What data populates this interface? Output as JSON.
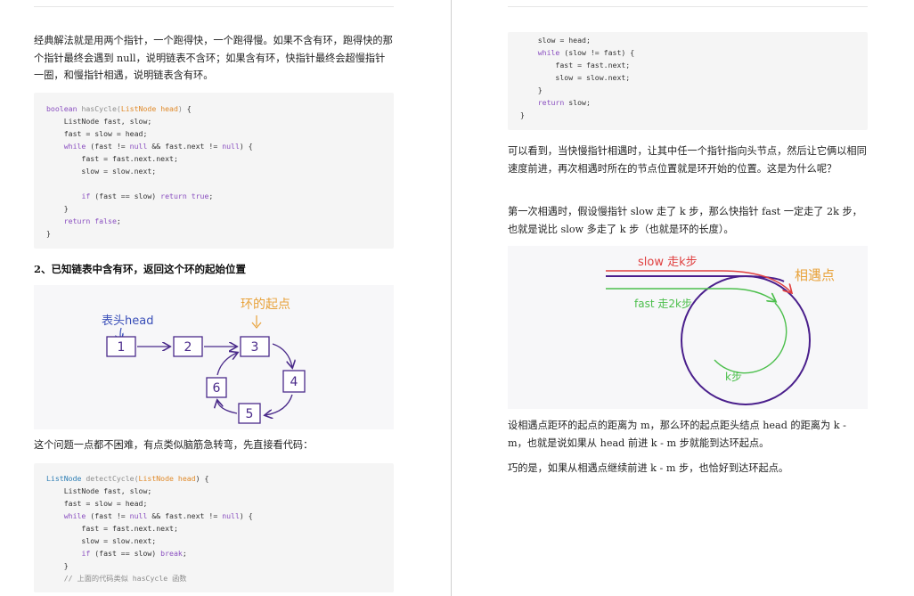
{
  "left": {
    "para1": "经典解法就是用两个指针，一个跑得快，一个跑得慢。如果不含有环，跑得快的那个指针最终会遇到 null，说明链表不含环；如果含有环，快指针最终会超慢指针一圈，和慢指针相遇，说明链表含有环。",
    "code1": {
      "l1": {
        "a": "boolean",
        "b": " ",
        "c": "hasCycle(",
        "d": "ListNode head",
        "e": ")",
        " f": ""
      },
      "l1_tail": " {",
      "l2": "    ListNode fast, slow;",
      "l3": "    fast = slow = head;",
      "l4a": "    ",
      "l4b": "while",
      "l4c": " (fast != ",
      "l4d": "null",
      "l4e": " && fast.next != ",
      "l4f": "null",
      "l4g": ") {",
      "l5": "        fast = fast.next.next;",
      "l6": "        slow = slow.next;",
      "l7": "",
      "l8a": "        ",
      "l8b": "if",
      "l8c": " (fast == slow) ",
      "l8d": "return",
      "l8e": " ",
      "l8f": "true",
      "l8g": ";",
      "l9": "    }",
      "l10a": "    ",
      "l10b": "return",
      "l10c": " ",
      "l10d": "false",
      "l10e": ";",
      "l11": "}"
    },
    "heading2": "2、已知链表中含有环，返回这个环的起始位置",
    "fig1": {
      "head_label": "表头head",
      "start_label": "环的起点",
      "nodes": [
        "1",
        "2",
        "3",
        "4",
        "5",
        "6"
      ]
    },
    "para2": "这个问题一点都不困难，有点类似脑筋急转弯，先直接看代码：",
    "code2": {
      "l1a": "ListNode",
      "l1b": " detectCycle(",
      "l1c": "ListNode head",
      "l1d": ") {",
      "l2": "    ListNode fast, slow;",
      "l3": "    fast = slow = head;",
      "l4a": "    ",
      "l4b": "while",
      "l4c": " (fast != ",
      "l4d": "null",
      "l4e": " && fast.next != ",
      "l4f": "null",
      "l4g": ") {",
      "l5": "        fast = fast.next.next;",
      "l6": "        slow = slow.next;",
      "l7a": "        ",
      "l7b": "if",
      "l7c": " (fast == slow) ",
      "l7d": "break",
      "l7e": ";",
      "l8": "    }",
      "l9": "    // 上面的代码类似 hasCycle 函数"
    }
  },
  "right": {
    "code3": {
      "l1": "    slow = head;",
      "l2a": "    ",
      "l2b": "while",
      "l2c": " (slow != fast) {",
      "l3": "        fast = fast.next;",
      "l4": "        slow = slow.next;",
      "l5": "    }",
      "l6a": "    ",
      "l6b": "return",
      "l6c": " slow;",
      "l7": "}"
    },
    "para3": "可以看到，当快慢指针相遇时，让其中任一个指针指向头节点，然后让它俩以相同速度前进，再次相遇时所在的节点位置就是环开始的位置。这是为什么呢？",
    "para4": "第一次相遇时，假设慢指针 slow 走了 k 步，那么快指针 fast 一定走了 2k 步，也就是说比 slow 多走了 k 步（也就是环的长度）。",
    "fig2": {
      "slow_label": "slow 走k步",
      "fast_label": "fast 走2k步",
      "meet_label": "相遇点",
      "k_label": "k步",
      "slow_color": "#e04040",
      "fast_color": "#4cbf4c",
      "ring_color": "#4a1f8c"
    },
    "para5": "设相遇点距环的起点的距离为 m，那么环的起点距头结点 head 的距离为 k - m，也就是说如果从 head 前进 k - m 步就能到达环起点。",
    "para6": "巧的是，如果从相遇点继续前进 k - m 步，也恰好到达环起点。"
  }
}
